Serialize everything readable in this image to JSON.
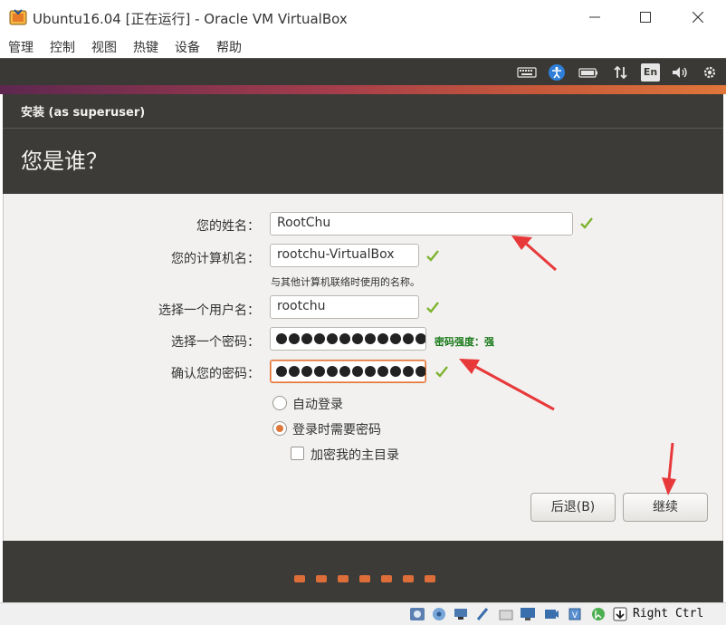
{
  "window": {
    "title": "Ubuntu16.04 [正在运行] - Oracle VM VirtualBox",
    "app_icon": "virtualbox-icon"
  },
  "menu": [
    "管理",
    "控制",
    "视图",
    "热键",
    "设备",
    "帮助"
  ],
  "panel": {
    "icons": [
      "keyboard-icon",
      "accessibility-icon",
      "battery-icon",
      "network-icon",
      "language-indicator-icon",
      "volume-icon",
      "settings-gear-icon"
    ],
    "language": "En"
  },
  "installer": {
    "window_title": "安装 (as superuser)",
    "heading": "您是谁？",
    "name": {
      "label": "您的姓名：",
      "value": "RootChu"
    },
    "computer": {
      "label": "您的计算机名：",
      "value": "rootchu-VirtualBox",
      "hint": "与其他计算机联络时使用的名称。"
    },
    "username": {
      "label": "选择一个用户名：",
      "value": "rootchu"
    },
    "password": {
      "label": "选择一个密码：",
      "masked_length": 13,
      "strength": "密码强度：强"
    },
    "confirm": {
      "label": "确认您的密码：",
      "masked_length": 13
    },
    "login_options": {
      "auto_login": {
        "label": "自动登录",
        "selected": false
      },
      "require_password": {
        "label": "登录时需要密码",
        "selected": true
      },
      "encrypt_home": {
        "label": "加密我的主目录",
        "checked": false
      }
    },
    "back_button": "后退(B)",
    "continue_button": "继续",
    "slideshow_pages": 7
  },
  "statusbar": {
    "icons": [
      "optical-drive-icon",
      "audio-icon",
      "network-adapter-icon",
      "usb-icon",
      "shared-folders-icon",
      "display-icon",
      "video-capture-icon",
      "cpu-virtualization-icon",
      "mouse-integration-icon",
      "keyboard-capture-icon"
    ],
    "host_key": "Right Ctrl"
  },
  "colors": {
    "accent": "#e0763a",
    "annotation_arrow": "#e8393a",
    "header_bg": "#3c3b37",
    "valid_check": "#7db32e",
    "strength_text": "#1a7a1a"
  }
}
